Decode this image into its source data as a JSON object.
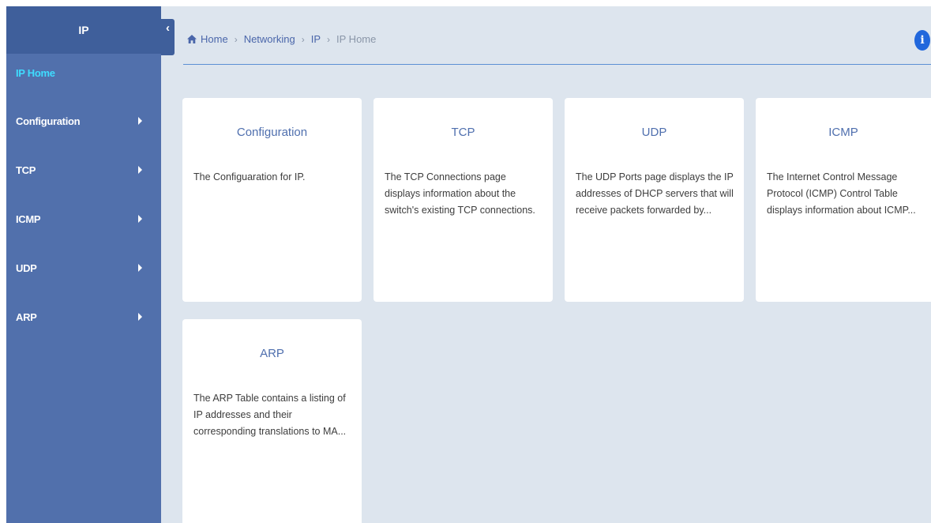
{
  "sidebar": {
    "title": "IP",
    "items": [
      {
        "label": "IP Home",
        "active": true
      },
      {
        "label": "Configuration"
      },
      {
        "label": "TCP"
      },
      {
        "label": "ICMP"
      },
      {
        "label": "UDP"
      },
      {
        "label": "ARP"
      }
    ],
    "collapse_glyph": "‹"
  },
  "breadcrumb": {
    "home": "Home",
    "items": [
      "Networking",
      "IP"
    ],
    "current": "IP Home",
    "separator": "›"
  },
  "info_glyph": "i",
  "icons": {
    "home": "home-icon",
    "info": "info-icon",
    "chevron": "chevron-right-icon",
    "collapse": "chevron-left-icon"
  },
  "colors": {
    "sidebar": "#5170ac",
    "sidebar_header": "#3f5f9b",
    "active_item": "#3fdcff",
    "content_bg": "#dde5ee",
    "card_title": "#4f6fae",
    "info": "#2167dc"
  },
  "cards": [
    {
      "title": "Configuration",
      "description": "The Configuaration for IP."
    },
    {
      "title": "TCP",
      "description": "The TCP Connections page displays information about the switch's existing TCP connections."
    },
    {
      "title": "UDP",
      "description": "The UDP Ports page displays the IP addresses of DHCP servers that will receive packets forwarded by..."
    },
    {
      "title": "ICMP",
      "description": "The Internet Control Message Protocol (ICMP) Control Table displays information about ICMP..."
    },
    {
      "title": "ARP",
      "description": "The ARP Table contains a listing of IP addresses and their corresponding translations to MA..."
    }
  ]
}
